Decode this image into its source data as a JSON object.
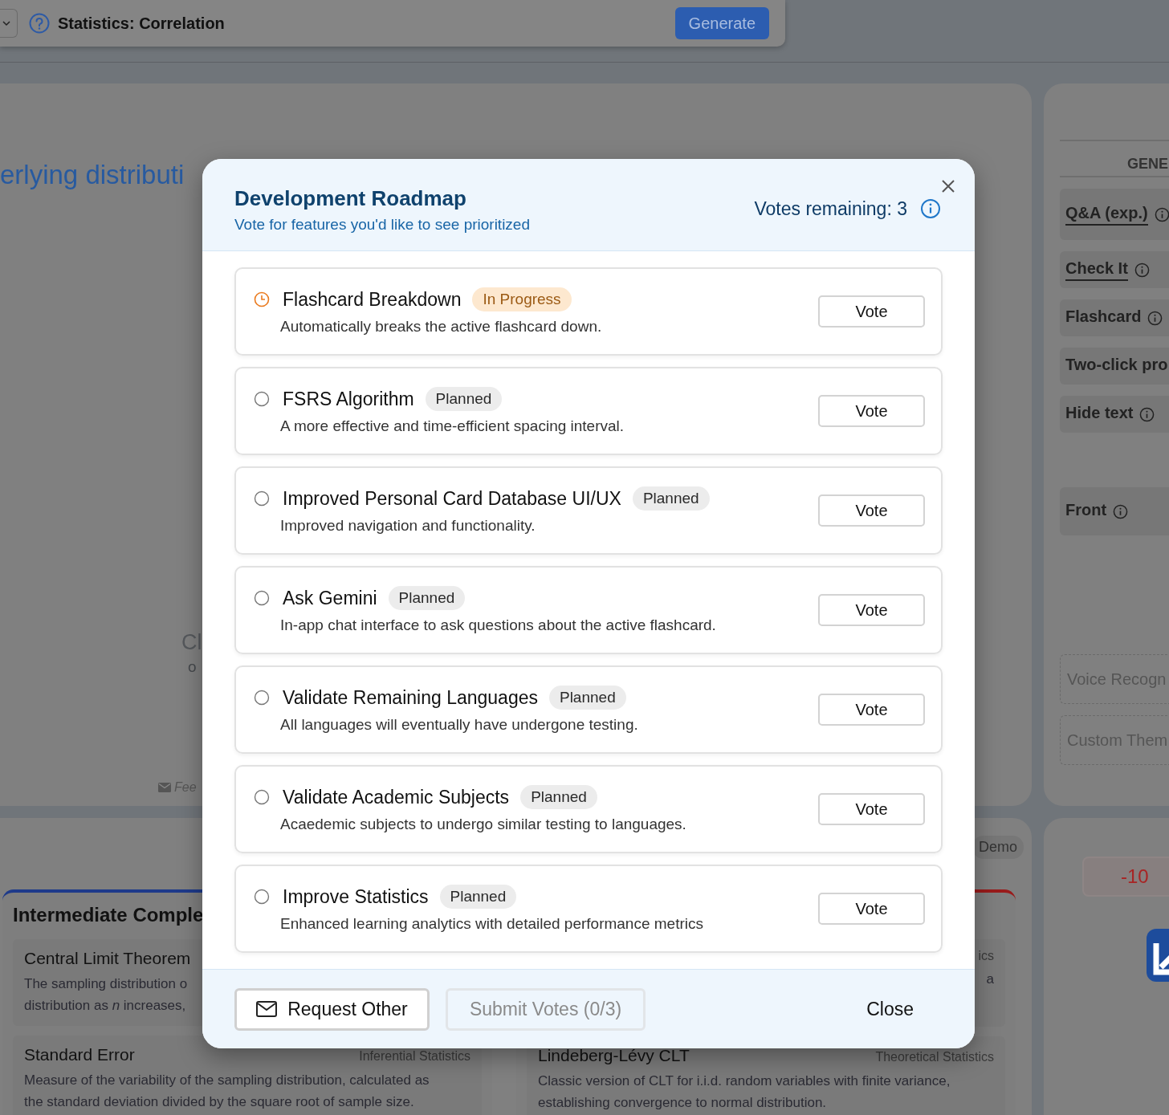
{
  "toolbar": {
    "title": "Statistics: Correlation",
    "button": "Generate"
  },
  "main_panel": {
    "heading": "erlying distributi",
    "empty_title": "Cl",
    "empty_text": "o",
    "feedback_link": "Fee"
  },
  "settings_panel": {
    "section": "GENE",
    "options": [
      {
        "label": "Q&A (exp.)",
        "selected": true,
        "info": true
      },
      {
        "label": "Check It",
        "selected": true,
        "info": true
      },
      {
        "label": "Flashcard",
        "selected": false,
        "info": true
      },
      {
        "label": "Two-click pro",
        "selected": false,
        "info": false
      },
      {
        "label": "Hide text",
        "selected": false,
        "info": true
      },
      {
        "label": "Front",
        "selected": false,
        "info": true
      }
    ],
    "dashed_options": [
      "Voice Recogn",
      "Custom Them"
    ]
  },
  "concepts": {
    "badge": "Demo",
    "groups": [
      {
        "title": "Intermediate Comple",
        "color": "#1e3a8a",
        "items": [
          {
            "title": "Central Limit Theorem",
            "description": "The sampling distribution o\ndistribution as *n* increases,"
          },
          {
            "title": "Standard Error",
            "tag": "Inferential Statistics",
            "description": "Measure of the variability of the sampling distribution, calculated as\nthe standard deviation divided by the square root of sample size."
          }
        ]
      },
      {
        "color": "#991b1b",
        "items": [
          {
            "tag": "ics",
            "description": "a"
          },
          {
            "title": "Lindeberg-Lévy CLT",
            "tag": "Theoretical Statistics",
            "description": "Classic version of CLT for i.i.d. random variables with finite variance,\nestablishing convergence to normal distribution."
          }
        ]
      }
    ]
  },
  "score": {
    "value": "-10"
  },
  "modal": {
    "title": "Development Roadmap",
    "subtitle": "Vote for features you'd like to see prioritized",
    "votes_remaining": "Votes remaining: 3",
    "features": [
      {
        "title": "Flashcard Breakdown",
        "status": "In Progress",
        "kind": "in_progress",
        "description": "Automatically breaks the active flashcard down.",
        "vote": "Vote"
      },
      {
        "title": "FSRS Algorithm",
        "status": "Planned",
        "kind": "planned",
        "description": "A more effective and time-efficient spacing interval.",
        "vote": "Vote"
      },
      {
        "title": "Improved Personal Card Database UI/UX",
        "status": "Planned",
        "kind": "planned",
        "description": "Improved navigation and functionality.",
        "vote": "Vote"
      },
      {
        "title": "Ask Gemini",
        "status": "Planned",
        "kind": "planned",
        "description": "In-app chat interface to ask questions about the active flashcard.",
        "vote": "Vote"
      },
      {
        "title": "Validate Remaining Languages",
        "status": "Planned",
        "kind": "planned",
        "description": "All languages will eventually have undergone testing.",
        "vote": "Vote"
      },
      {
        "title": "Validate Academic Subjects",
        "status": "Planned",
        "kind": "planned",
        "description": "Acaedemic subjects to undergo similar testing to languages.",
        "vote": "Vote"
      },
      {
        "title": "Improve Statistics",
        "status": "Planned",
        "kind": "planned",
        "description": "Enhanced learning analytics with detailed performance metrics",
        "vote": "Vote"
      }
    ],
    "footer": {
      "request": "Request Other",
      "submit": {
        "label": "Submit Votes (0/3)",
        "disabled": true
      },
      "close": "Close"
    }
  }
}
